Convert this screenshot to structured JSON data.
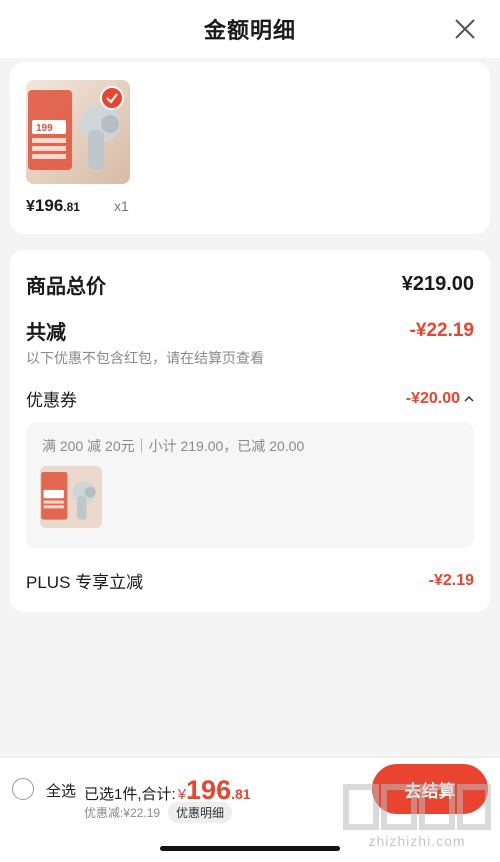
{
  "header": {
    "title": "金额明细",
    "close_icon": "close-icon"
  },
  "product": {
    "price_yen": "¥",
    "price_int": "196",
    "price_dec": ".81",
    "quantity": "x1",
    "thumb_caption": "199",
    "selected": true
  },
  "summary": {
    "total_label": "商品总价",
    "total_value": "¥219.00",
    "reduce_label": "共减",
    "reduce_value": "-¥22.19",
    "reduce_note": "以下优惠不包含红包，请在结算页查看",
    "coupon_label": "优惠券",
    "coupon_value": "-¥20.00",
    "coupon_desc": "满 200 减 20元｜小计 219.00，已减 20.00",
    "plus_label": "PLUS 专享立减",
    "plus_value": "-¥2.19"
  },
  "bottom": {
    "select_all": "全选",
    "selected_total_prefix": "已选1件,合计:",
    "total_yen": "¥",
    "total_int": "196",
    "total_dec": ".81",
    "discount_text": "优惠减:¥22.19",
    "detail_chip": "优惠明细",
    "checkout_label": "去结算"
  },
  "watermark": {
    "text": "值 什么值得买",
    "url": "zhizhizhi.com"
  },
  "colors": {
    "accent": "#e8442f",
    "bg": "#f4f4f4",
    "card": "#ffffff"
  }
}
